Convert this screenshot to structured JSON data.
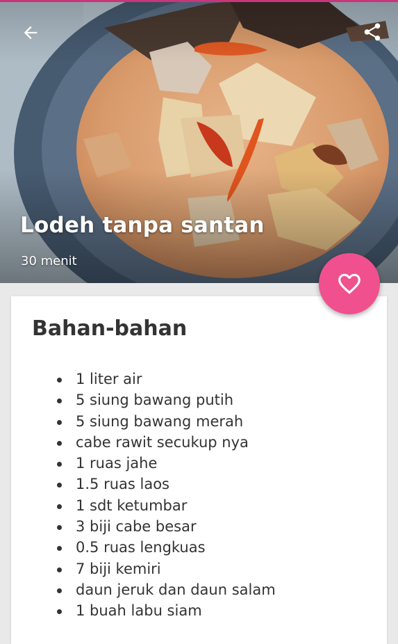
{
  "recipe": {
    "title": "Lodeh tanpa santan",
    "duration": "30 menit"
  },
  "header": {
    "back_icon": "arrow-left-icon",
    "share_icon": "share-icon"
  },
  "fab": {
    "icon": "heart-outline-icon",
    "color": "#f0508e"
  },
  "ingredients": {
    "title": "Bahan-bahan",
    "items": [
      "1 liter air",
      "5 siung bawang putih",
      "5 siung bawang merah",
      "cabe rawit secukup nya",
      "1 ruas jahe",
      "1.5 ruas laos",
      "1 sdt ketumbar",
      "3 biji cabe besar",
      "0.5 ruas lengkuas",
      "7 biji kemiri",
      "daun jeruk dan daun salam",
      "1 buah labu siam"
    ]
  },
  "colors": {
    "accent": "#f0508e",
    "status_bar": "#c8357a",
    "text": "#333333",
    "background": "#e9e9e9"
  }
}
